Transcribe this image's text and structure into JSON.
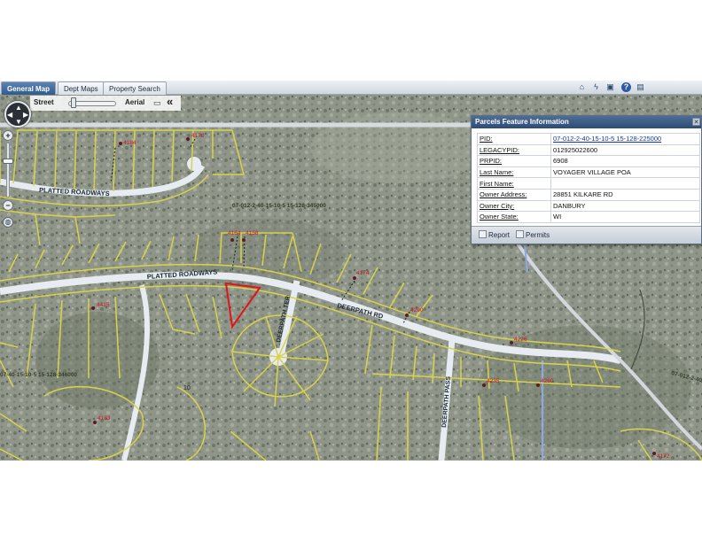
{
  "tabs": [
    {
      "label": "General Map",
      "active": true
    },
    {
      "label": "Dept Maps",
      "active": false
    },
    {
      "label": "Property Search",
      "active": false
    }
  ],
  "toolbar_icons": [
    "home-icon",
    "lightning-icon",
    "lock-icon",
    "help-icon",
    "identify-icon"
  ],
  "basemap": {
    "street": "Street",
    "aerial": "Aerial",
    "collapse": "«"
  },
  "map_labels": {
    "platted_roadways_top": "PLATTED ROADWAYS",
    "platted_roadways_mid": "PLATTED ROADWAYS",
    "deerpath_rd": "DEERPATH RD",
    "deerpath_ter": "DEERPATH TER",
    "deerpath_pass": "DEERPATH PASS",
    "parcel_345000": "07-012-2-40-15-10-5 15-128-345000",
    "parcel_346000": "07-40-15-10-5 15-128-346000",
    "parcel_right_edge": "07-012-2-40",
    "lot_10": "10"
  },
  "address_points": [
    "4164",
    "4170",
    "4184",
    "4158",
    "4174",
    "4415",
    "4290",
    "4226",
    "4235",
    "4260",
    "4183",
    "4172"
  ],
  "colors": {
    "parcel_line": "#d8d34a",
    "selected_parcel": "#e0141b",
    "road_fill": "#e6ecf2",
    "water_line": "#8fa7e8",
    "address_label": "#d1161b"
  },
  "popup": {
    "title": "Parcels Feature Information",
    "rows": [
      {
        "key": "PID:",
        "value": "07-012-2-40-15-10-5 15-128-225000",
        "link": true
      },
      {
        "key": "LEGACYPID:",
        "value": "012925022600",
        "link": false
      },
      {
        "key": "PRPID:",
        "value": "6908",
        "link": false
      },
      {
        "key": "Last Name:",
        "value": "VOYAGER VILLAGE POA",
        "link": false
      },
      {
        "key": "First Name:",
        "value": "",
        "link": false
      },
      {
        "key": "Owner Address:",
        "value": "28851 KILKARE RD",
        "link": false
      },
      {
        "key": "Owner City:",
        "value": "DANBURY",
        "link": false
      },
      {
        "key": "Owner State:",
        "value": "WI",
        "link": false
      }
    ],
    "report_label": "Report",
    "permits_label": "Permits"
  }
}
